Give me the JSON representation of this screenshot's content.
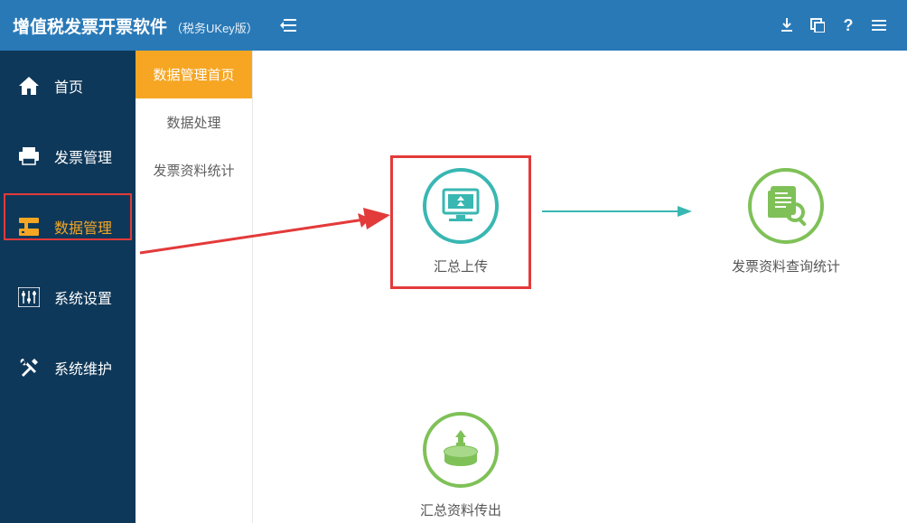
{
  "header": {
    "app_title": "增值税发票开票软件",
    "app_subtitle": "（税务UKey版）"
  },
  "sidebar": {
    "items": [
      {
        "label": "首页"
      },
      {
        "label": "发票管理"
      },
      {
        "label": "数据管理"
      },
      {
        "label": "系统设置"
      },
      {
        "label": "系统维护"
      }
    ]
  },
  "submenu": {
    "items": [
      {
        "label": "数据管理首页"
      },
      {
        "label": "数据处理"
      },
      {
        "label": "发票资料统计"
      }
    ]
  },
  "cards": {
    "upload": {
      "caption": "汇总上传"
    },
    "query": {
      "caption": "发票资料查询统计"
    },
    "export": {
      "caption": "汇总资料传出"
    }
  }
}
